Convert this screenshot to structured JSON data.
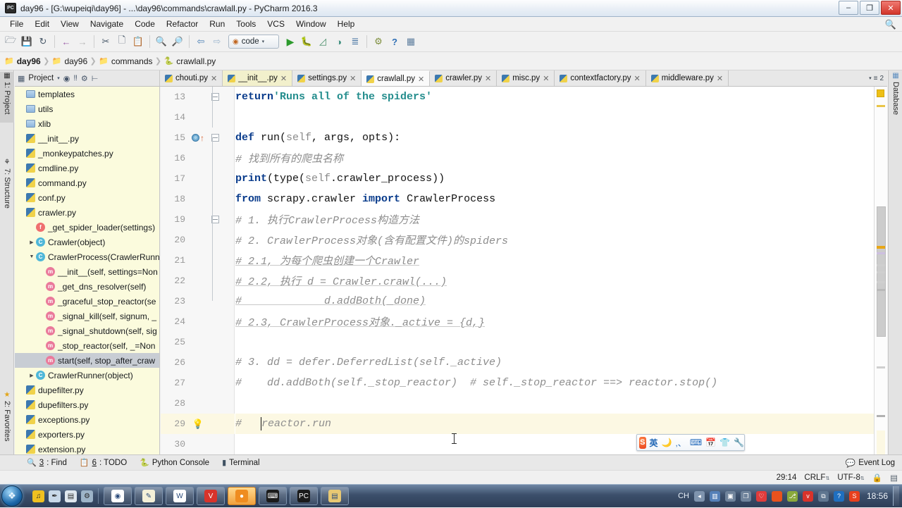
{
  "window": {
    "title": "day96 - [G:\\wupeiqi\\day96] - ...\\day96\\commands\\crawlall.py - PyCharm 2016.3",
    "app_icon": "pycharm-icon",
    "minimize": "–",
    "maximize": "❐",
    "close": "✕"
  },
  "menubar": {
    "items": [
      "File",
      "Edit",
      "View",
      "Navigate",
      "Code",
      "Refactor",
      "Run",
      "Tools",
      "VCS",
      "Window",
      "Help"
    ],
    "search_icon": "search-icon"
  },
  "toolbar": {
    "icons": [
      "open-folder-icon",
      "save-all-icon",
      "sync-icon",
      "undo-icon",
      "redo-icon",
      "cut-icon",
      "copy-icon",
      "paste-icon",
      "find-icon",
      "replace-icon",
      "back-icon",
      "forward-icon"
    ],
    "run_config": {
      "label": "code",
      "icon": "run-config-icon",
      "chevron": "▾"
    },
    "run_icons": [
      "run-icon",
      "debug-icon",
      "coverage-icon",
      "profile-icon",
      "attach-icon"
    ],
    "right_icons": [
      "settings-icon",
      "help-icon",
      "database-icon"
    ]
  },
  "breadcrumb": {
    "items": [
      {
        "label": "day96",
        "icon": "folder-icon",
        "bold": true
      },
      {
        "label": "day96",
        "icon": "folder-icon",
        "bold": false
      },
      {
        "label": "commands",
        "icon": "folder-icon",
        "bold": false
      },
      {
        "label": "crawlall.py",
        "icon": "python-file-icon",
        "bold": false
      }
    ],
    "separator": "❯"
  },
  "left_strip": {
    "tabs": [
      {
        "label": "1: Project",
        "icon": "project-icon",
        "selected": true
      },
      {
        "label": "7: Structure",
        "icon": "structure-icon",
        "selected": false
      },
      {
        "label": "2: Favorites",
        "icon": "star-icon",
        "selected": false
      }
    ]
  },
  "right_strip": {
    "tabs": [
      {
        "label": "Database",
        "icon": "database-icon"
      }
    ]
  },
  "project_pane": {
    "title": "Project",
    "header_icons": [
      "project-view-icon",
      "chevron-down-icon",
      "target-icon",
      "collapse-icon",
      "settings-icon",
      "hide-icon"
    ],
    "tree": [
      {
        "label": "templates",
        "indent": 0,
        "icon": "folder",
        "twisty": ""
      },
      {
        "label": "utils",
        "indent": 0,
        "icon": "folder",
        "twisty": ""
      },
      {
        "label": "xlib",
        "indent": 0,
        "icon": "folder",
        "twisty": ""
      },
      {
        "label": "__init__.py",
        "indent": 0,
        "icon": "python",
        "twisty": ""
      },
      {
        "label": "_monkeypatches.py",
        "indent": 0,
        "icon": "python",
        "twisty": ""
      },
      {
        "label": "cmdline.py",
        "indent": 0,
        "icon": "python",
        "twisty": ""
      },
      {
        "label": "command.py",
        "indent": 0,
        "icon": "python",
        "twisty": ""
      },
      {
        "label": "conf.py",
        "indent": 0,
        "icon": "python",
        "twisty": ""
      },
      {
        "label": "crawler.py",
        "indent": 0,
        "icon": "python",
        "twisty": ""
      },
      {
        "label": "_get_spider_loader(settings)",
        "indent": 1,
        "icon": "function",
        "twisty": ""
      },
      {
        "label": "Crawler(object)",
        "indent": 1,
        "icon": "class",
        "twisty": "▶"
      },
      {
        "label": "CrawlerProcess(CrawlerRunn",
        "indent": 1,
        "icon": "class",
        "twisty": "▼"
      },
      {
        "label": "__init__(self, settings=Non",
        "indent": 2,
        "icon": "method",
        "twisty": ""
      },
      {
        "label": "_get_dns_resolver(self)",
        "indent": 2,
        "icon": "method",
        "twisty": ""
      },
      {
        "label": "_graceful_stop_reactor(se",
        "indent": 2,
        "icon": "method",
        "twisty": ""
      },
      {
        "label": "_signal_kill(self, signum, _",
        "indent": 2,
        "icon": "method",
        "twisty": ""
      },
      {
        "label": "_signal_shutdown(self, sig",
        "indent": 2,
        "icon": "method",
        "twisty": ""
      },
      {
        "label": "_stop_reactor(self, _=Non",
        "indent": 2,
        "icon": "method",
        "twisty": ""
      },
      {
        "label": "start(self, stop_after_craw",
        "indent": 2,
        "icon": "method",
        "twisty": "",
        "selected": true
      },
      {
        "label": "CrawlerRunner(object)",
        "indent": 1,
        "icon": "class",
        "twisty": "▶"
      },
      {
        "label": "dupefilter.py",
        "indent": 0,
        "icon": "python",
        "twisty": ""
      },
      {
        "label": "dupefilters.py",
        "indent": 0,
        "icon": "python",
        "twisty": ""
      },
      {
        "label": "exceptions.py",
        "indent": 0,
        "icon": "python",
        "twisty": ""
      },
      {
        "label": "exporters.py",
        "indent": 0,
        "icon": "python",
        "twisty": ""
      },
      {
        "label": "extension.py",
        "indent": 0,
        "icon": "python",
        "twisty": ""
      }
    ]
  },
  "editor_tabs": {
    "tabs": [
      {
        "label": "chouti.py",
        "state": "normal",
        "close": "✕"
      },
      {
        "label": "__init__.py",
        "state": "modified",
        "close": "✕"
      },
      {
        "label": "settings.py",
        "state": "normal",
        "close": "✕"
      },
      {
        "label": "crawlall.py",
        "state": "selected",
        "close": "✕"
      },
      {
        "label": "crawler.py",
        "state": "normal",
        "close": "✕"
      },
      {
        "label": "misc.py",
        "state": "normal",
        "close": "✕"
      },
      {
        "label": "contextfactory.py",
        "state": "normal",
        "close": "✕"
      },
      {
        "label": "middleware.py",
        "state": "normal",
        "close": "✕"
      }
    ],
    "overflow_count": "2",
    "overflow_icon": "tab-list-icon"
  },
  "editor": {
    "first_line": 13,
    "highlighted_line": 29,
    "caret_line": 29,
    "lines": [
      {
        "n": 13,
        "fold": "end",
        "marker": "",
        "text": "        return 'Runs all of the spiders'"
      },
      {
        "n": 14,
        "fold": "",
        "marker": "",
        "text": ""
      },
      {
        "n": 15,
        "fold": "start",
        "marker": "breakpoint-override",
        "text": "    def run(self, args, opts):"
      },
      {
        "n": 16,
        "fold": "",
        "marker": "",
        "text": "        # 找到所有的爬虫名称"
      },
      {
        "n": 17,
        "fold": "",
        "marker": "",
        "text": "        print(type(self.crawler_process))"
      },
      {
        "n": 18,
        "fold": "",
        "marker": "",
        "text": "        from scrapy.crawler import CrawlerProcess"
      },
      {
        "n": 19,
        "fold": "start",
        "marker": "",
        "text": "        # 1. 执行CrawlerProcess构造方法"
      },
      {
        "n": 20,
        "fold": "",
        "marker": "",
        "text": "        # 2. CrawlerProcess对象(含有配置文件)的spiders"
      },
      {
        "n": 21,
        "fold": "",
        "marker": "",
        "text": "            # 2.1, 为每个爬虫创建一个Crawler"
      },
      {
        "n": 22,
        "fold": "",
        "marker": "",
        "text": "            # 2.2, 执行 d = Crawler.crawl(...)"
      },
      {
        "n": 23,
        "fold": "",
        "marker": "",
        "text": "            #             d.addBoth(_done)"
      },
      {
        "n": 24,
        "fold": "",
        "marker": "",
        "text": "            # 2.3, CrawlerProcess对象._active = {d,}"
      },
      {
        "n": 25,
        "fold": "",
        "marker": "",
        "text": ""
      },
      {
        "n": 26,
        "fold": "",
        "marker": "",
        "text": "        # 3. dd = defer.DeferredList(self._active)"
      },
      {
        "n": 27,
        "fold": "",
        "marker": "",
        "text": "        #    dd.addBoth(self._stop_reactor)  # self._stop_reactor ==> reactor.stop()"
      },
      {
        "n": 28,
        "fold": "",
        "marker": "",
        "text": ""
      },
      {
        "n": 29,
        "fold": "",
        "marker": "bulb",
        "text": "        #   reactor.run"
      },
      {
        "n": 30,
        "fold": "",
        "marker": "",
        "text": ""
      }
    ]
  },
  "ime": {
    "logo": "S",
    "mode_label": "英",
    "icons": [
      "moon-icon",
      "comma-icon",
      "keyboard-icon",
      "calendar-icon",
      "skin-icon",
      "tools-icon"
    ]
  },
  "bottom_bar": {
    "items": [
      {
        "num": "3",
        "label": ": Find",
        "icon": "find-icon"
      },
      {
        "num": "6",
        "label": ": TODO",
        "icon": "todo-icon"
      },
      {
        "num": "",
        "label": "Python Console",
        "icon": "python-console-icon"
      },
      {
        "num": "",
        "label": "Terminal",
        "icon": "terminal-icon"
      }
    ],
    "event_log": {
      "label": "Event Log",
      "icon": "event-log-icon"
    }
  },
  "status_bar": {
    "caret_position": "29:14",
    "line_separator": "CRLF",
    "encoding": "UTF-8",
    "lock_icon": "lock-icon",
    "inspection_icon": "inspection-icon",
    "sep_arrow": "⇅"
  },
  "taskbar": {
    "start_icon": "windows-start-icon",
    "quick_launch": [
      {
        "name": "media-player-icon",
        "color": "#f0c020",
        "glyph": "♫"
      },
      {
        "name": "paint-icon",
        "color": "#c8d8e8",
        "glyph": "✒"
      },
      {
        "name": "save-icon",
        "color": "#dfe7ee",
        "glyph": "▤"
      },
      {
        "name": "tool-icon",
        "color": "#9db4c8",
        "glyph": "⚙"
      }
    ],
    "tasks": [
      {
        "name": "chrome-icon",
        "color": "#ffffff",
        "glyph": "◉",
        "active": false
      },
      {
        "name": "notepad-icon",
        "color": "#f4f0d8",
        "glyph": "✎",
        "active": false
      },
      {
        "name": "word-icon",
        "color": "#ffffff",
        "glyph": "W",
        "active": false
      },
      {
        "name": "vivaldi-icon",
        "color": "#d8332b",
        "glyph": "V",
        "active": false
      },
      {
        "name": "navicat-icon",
        "color": "#ef8c20",
        "glyph": "●",
        "active": true
      },
      {
        "name": "cmd-icon",
        "color": "#1b1b1b",
        "glyph": "⌨",
        "active": false
      },
      {
        "name": "pycharm-icon",
        "color": "#1b1b1b",
        "glyph": "PC",
        "active": false
      },
      {
        "name": "explorer-icon",
        "color": "#e8c873",
        "glyph": "▤",
        "active": false
      }
    ],
    "tray": {
      "lang": "CH",
      "icons": [
        {
          "name": "sogou-icon",
          "color": "#e8401d",
          "glyph": "S"
        },
        {
          "name": "help-icon",
          "color": "#1f6fc0",
          "glyph": "?"
        },
        {
          "name": "overflow-icon",
          "color": "#5f7690",
          "glyph": "⧉"
        },
        {
          "name": "vivaldi-tray-icon",
          "color": "#d8332b",
          "glyph": "v"
        },
        {
          "name": "tools-tray-icon",
          "color": "#8aa93c",
          "glyph": "⎇"
        },
        {
          "name": "dot-tray-icon",
          "color": "#e8521d",
          "glyph": ""
        },
        {
          "name": "shield-tray-icon",
          "color": "#e03c3c",
          "glyph": "♡"
        },
        {
          "name": "copy-tray-icon",
          "color": "#6f839b",
          "glyph": "❐"
        },
        {
          "name": "network-icon",
          "color": "#6f839b",
          "glyph": "▣"
        },
        {
          "name": "monitor-icon",
          "color": "#5580b8",
          "glyph": "▥"
        },
        {
          "name": "volume-icon",
          "color": "#7f94ae",
          "glyph": "◂"
        }
      ],
      "clock": "18:56"
    }
  }
}
